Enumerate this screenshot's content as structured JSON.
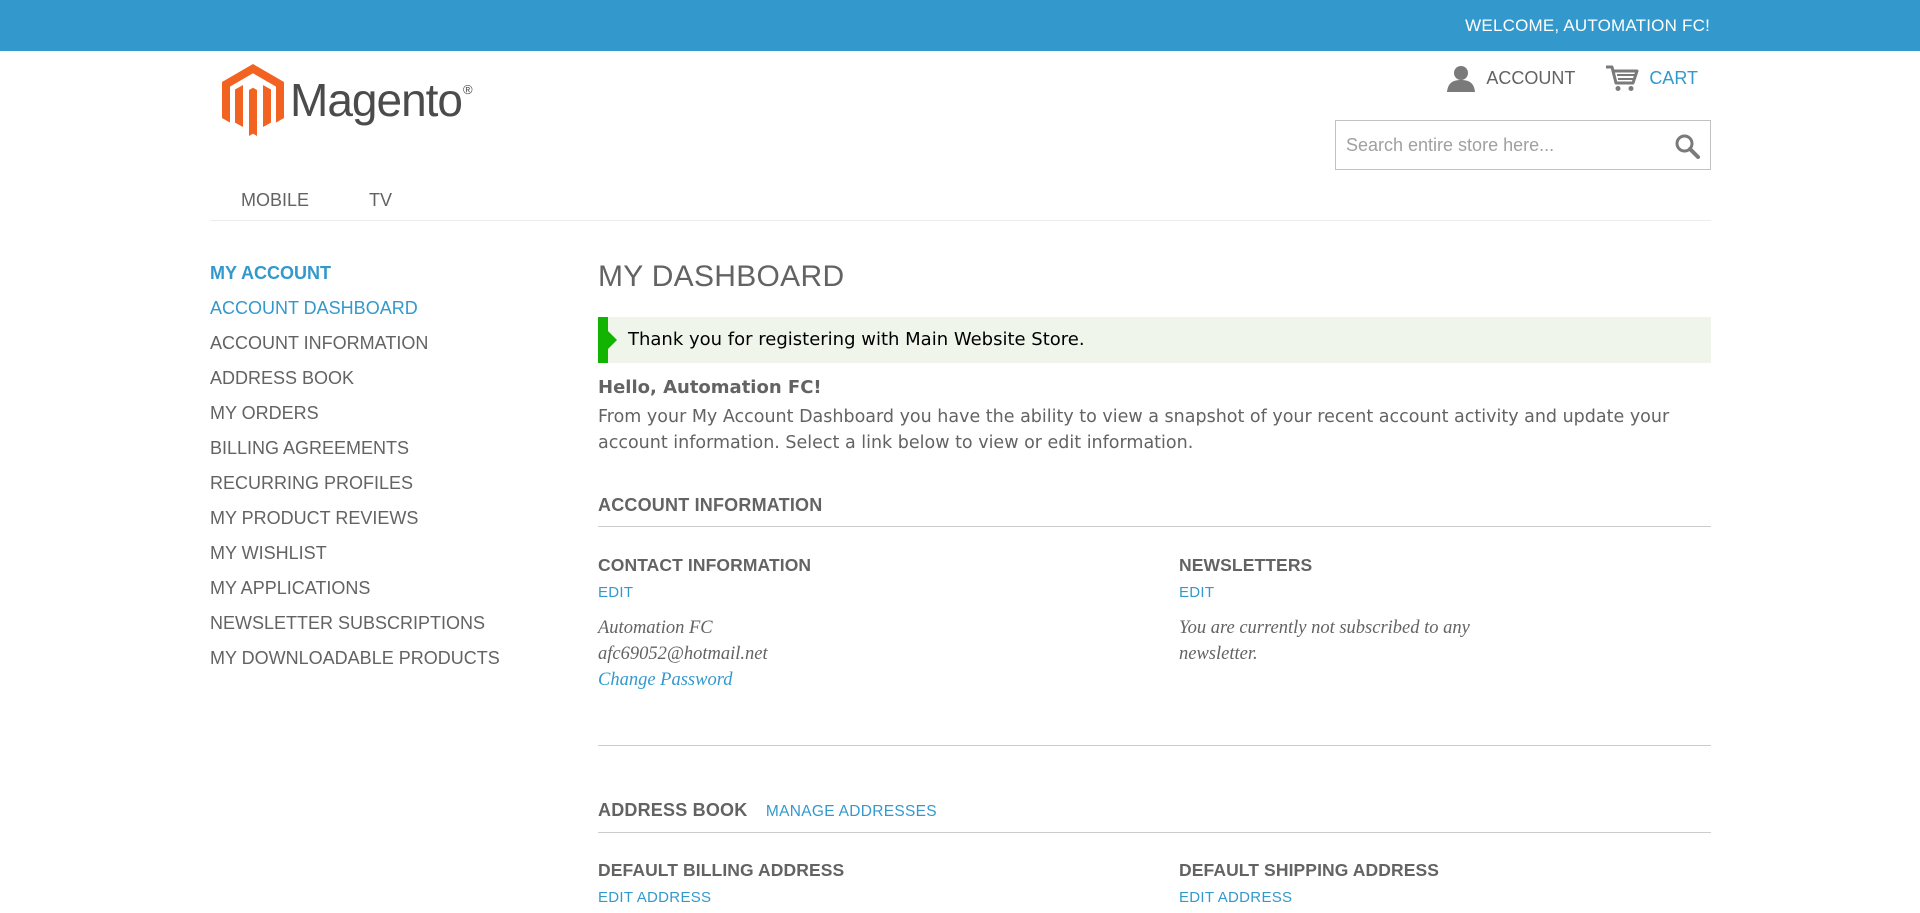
{
  "topbar": {
    "welcome": "WELCOME, AUTOMATION FC!",
    "color": "#3399cc"
  },
  "brand": {
    "name": "Magento",
    "registered_mark": "®",
    "logo_color": "#f26322"
  },
  "header": {
    "account_label": "ACCOUNT",
    "cart_label": "CART",
    "account_icon": "user-icon",
    "cart_icon": "cart-icon"
  },
  "search": {
    "placeholder": "Search entire store here...",
    "value": "",
    "icon": "search-icon"
  },
  "nav": {
    "items": [
      {
        "label": "MOBILE"
      },
      {
        "label": "TV"
      }
    ]
  },
  "sidebar": {
    "title": "MY ACCOUNT",
    "items": [
      {
        "label": "ACCOUNT DASHBOARD",
        "active": true
      },
      {
        "label": "ACCOUNT INFORMATION"
      },
      {
        "label": "ADDRESS BOOK"
      },
      {
        "label": "MY ORDERS"
      },
      {
        "label": "BILLING AGREEMENTS"
      },
      {
        "label": "RECURRING PROFILES"
      },
      {
        "label": "MY PRODUCT REVIEWS"
      },
      {
        "label": "MY WISHLIST"
      },
      {
        "label": "MY APPLICATIONS"
      },
      {
        "label": "NEWSLETTER SUBSCRIPTIONS"
      },
      {
        "label": "MY DOWNLOADABLE PRODUCTS"
      }
    ]
  },
  "main": {
    "title": "MY DASHBOARD",
    "success_message": "Thank you for registering with Main Website Store.",
    "success_color": "#11b400",
    "hello": "Hello, Automation FC!",
    "intro": "From your My Account Dashboard you have the ability to view a snapshot of your recent account activity and update your account information. Select a link below to view or edit information.",
    "account_info": {
      "title": "ACCOUNT INFORMATION",
      "contact": {
        "title": "CONTACT INFORMATION",
        "edit_label": "EDIT",
        "name": "Automation FC",
        "email": "afc69052@hotmail.net",
        "change_password": "Change Password"
      },
      "newsletters": {
        "title": "NEWSLETTERS",
        "edit_label": "EDIT",
        "text_line1": "You are currently not subscribed to any",
        "text_line2": "newsletter."
      }
    },
    "address_book": {
      "title": "ADDRESS BOOK",
      "manage_label": "MANAGE ADDRESSES",
      "billing": {
        "title": "DEFAULT BILLING ADDRESS",
        "edit_label": "EDIT ADDRESS"
      },
      "shipping": {
        "title": "DEFAULT SHIPPING ADDRESS",
        "edit_label": "EDIT ADDRESS"
      }
    }
  }
}
